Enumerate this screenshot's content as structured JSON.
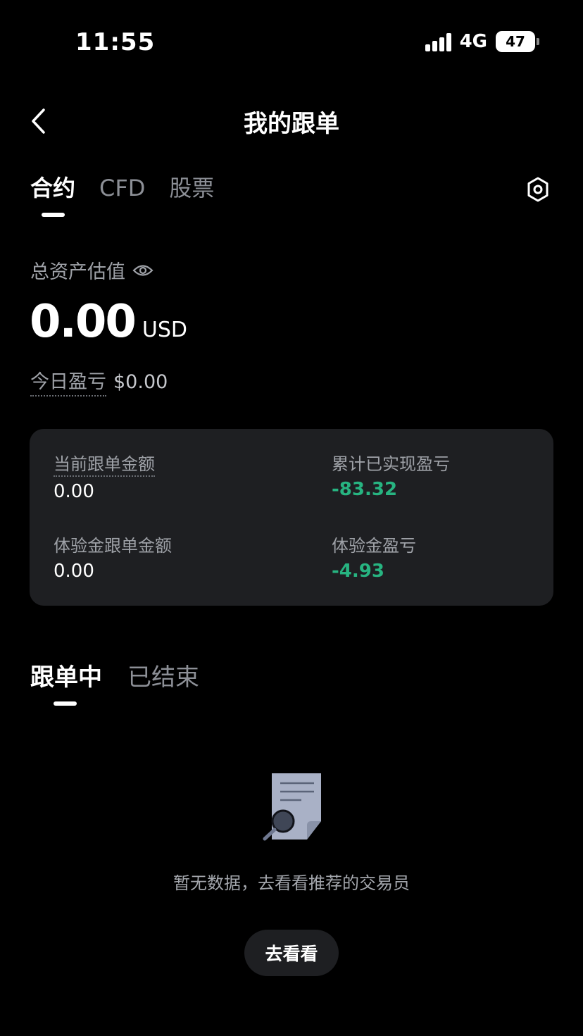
{
  "status_bar": {
    "time": "11:55",
    "network": "4G",
    "battery": "47"
  },
  "header": {
    "title": "我的跟单"
  },
  "top_tabs": [
    {
      "label": "合约",
      "active": true
    },
    {
      "label": "CFD",
      "active": false
    },
    {
      "label": "股票",
      "active": false
    }
  ],
  "assets": {
    "label": "总资产估值",
    "value": "0.00",
    "unit": "USD",
    "pnl_label": "今日盈亏",
    "pnl_value": "$0.00"
  },
  "summary": {
    "current_amount_label": "当前跟单金额",
    "current_amount_value": "0.00",
    "realized_pnl_label": "累计已实现盈亏",
    "realized_pnl_value": "-83.32",
    "trial_amount_label": "体验金跟单金额",
    "trial_amount_value": "0.00",
    "trial_pnl_label": "体验金盈亏",
    "trial_pnl_value": "-4.93"
  },
  "bottom_tabs": [
    {
      "label": "跟单中",
      "active": true
    },
    {
      "label": "已结束",
      "active": false
    }
  ],
  "empty_state": {
    "icon": "document-search-icon",
    "text": "暂无数据，去看看推荐的交易员",
    "button": "去看看"
  },
  "colors": {
    "background": "#000000",
    "card": "#1e1f22",
    "positive_negative_value": "#27b481"
  }
}
